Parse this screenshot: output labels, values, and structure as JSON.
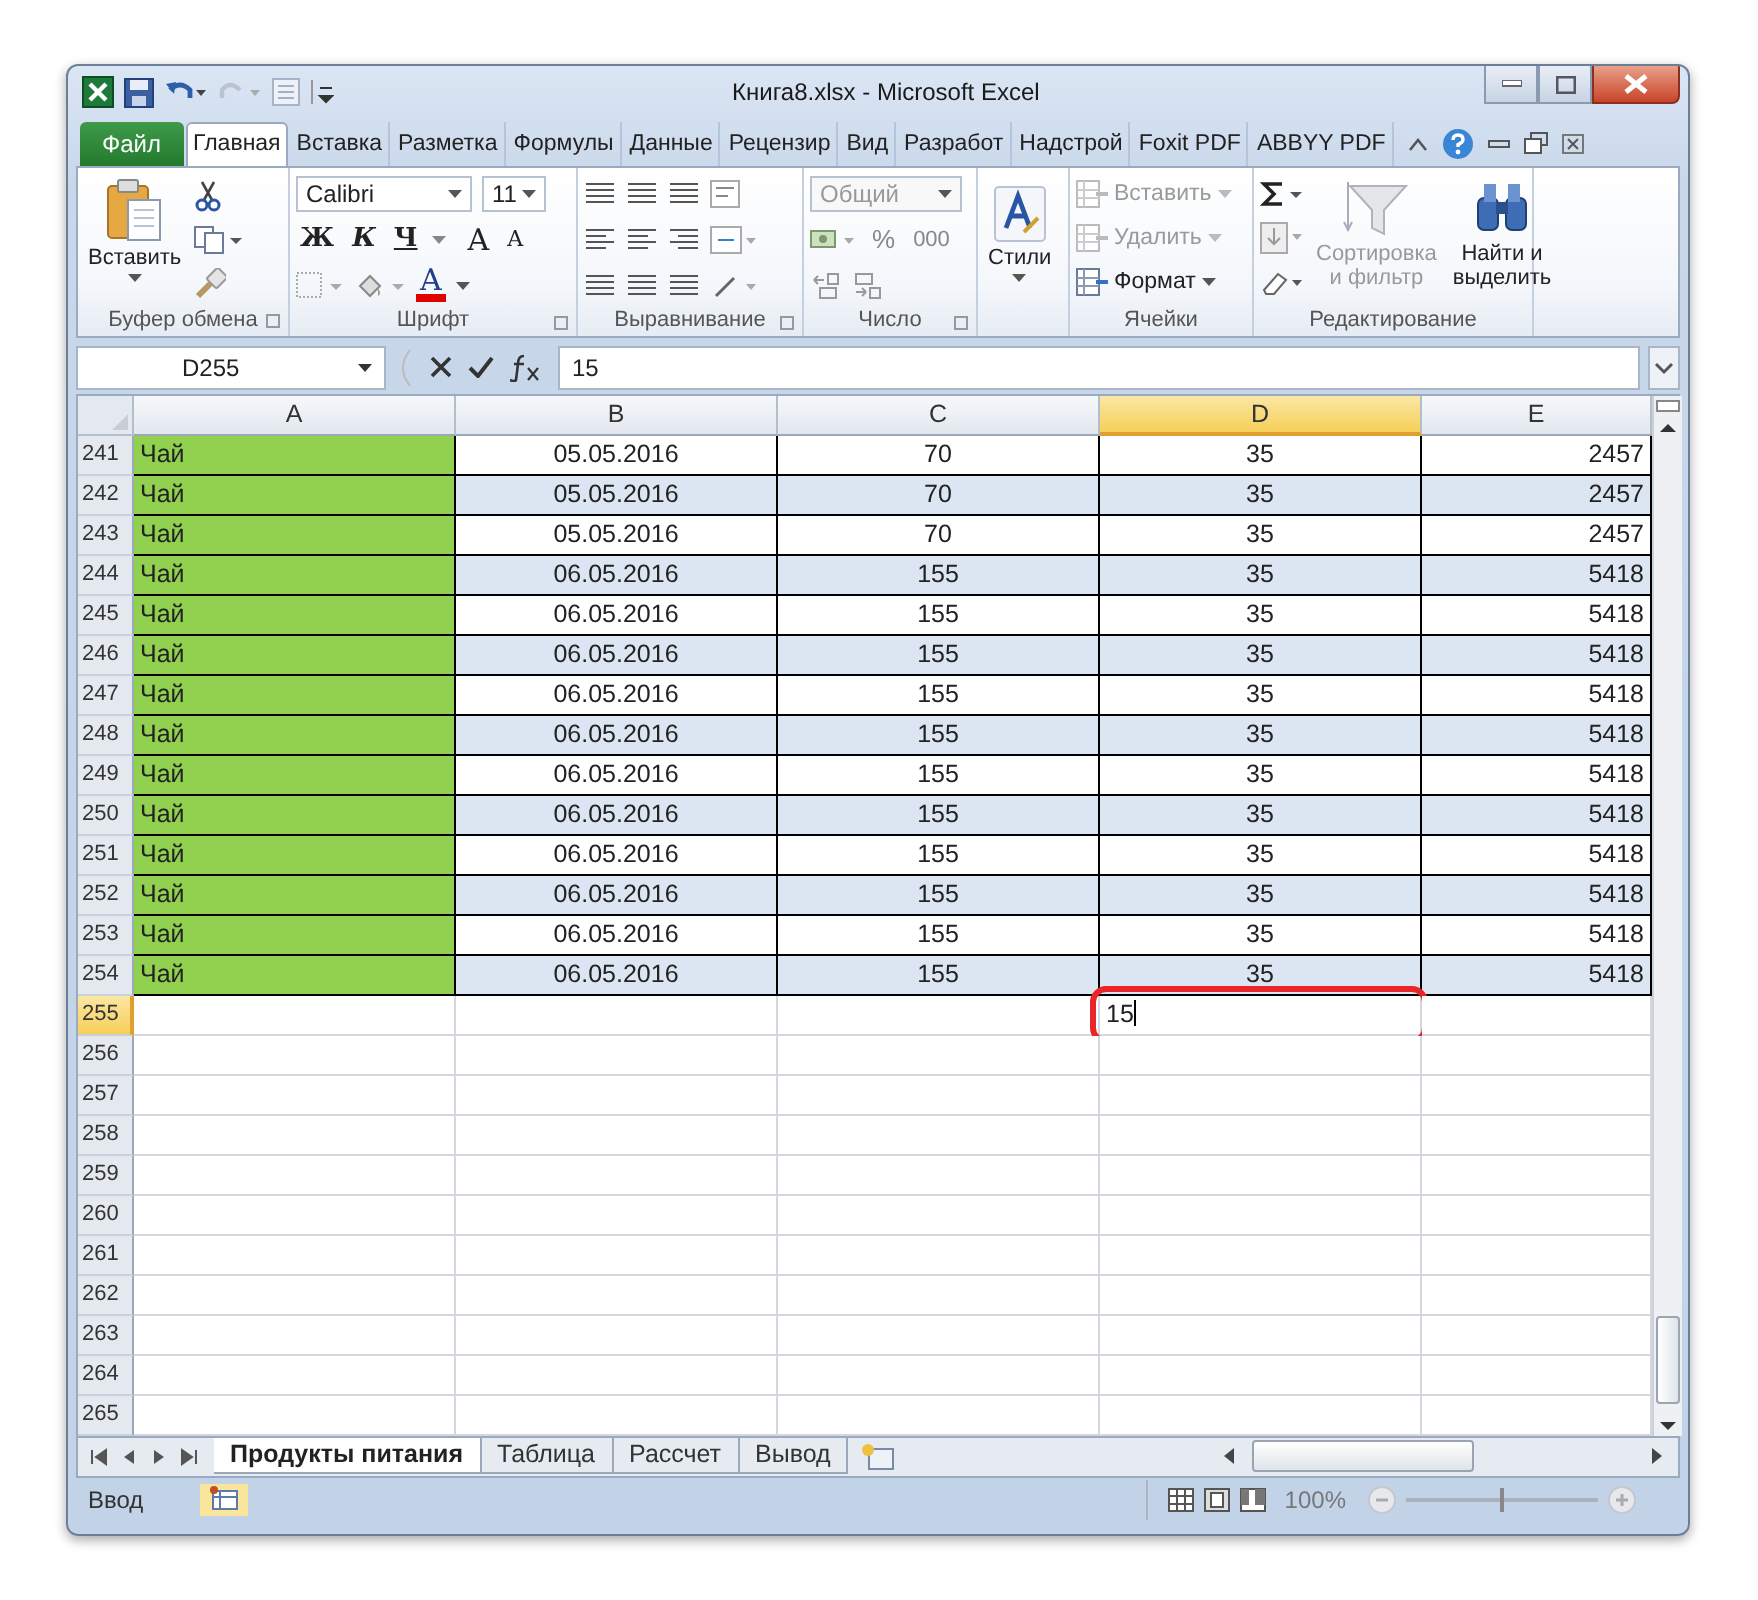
{
  "window": {
    "title": "Книга8.xlsx - Microsoft Excel"
  },
  "ribbon_tabs": [
    {
      "label": "Файл",
      "kind": "file",
      "selected": false
    },
    {
      "label": "Главная",
      "kind": "tab",
      "selected": true
    },
    {
      "label": "Вставка",
      "kind": "tab",
      "selected": false
    },
    {
      "label": "Разметка",
      "kind": "tab",
      "selected": false
    },
    {
      "label": "Формулы",
      "kind": "tab",
      "selected": false
    },
    {
      "label": "Данные",
      "kind": "tab",
      "selected": false
    },
    {
      "label": "Рецензир",
      "kind": "tab",
      "selected": false
    },
    {
      "label": "Вид",
      "kind": "tab",
      "selected": false
    },
    {
      "label": "Разработ",
      "kind": "tab",
      "selected": false
    },
    {
      "label": "Надстрой",
      "kind": "tab",
      "selected": false
    },
    {
      "label": "Foxit PDF",
      "kind": "tab",
      "selected": false
    },
    {
      "label": "ABBYY PDF",
      "kind": "tab",
      "selected": false
    }
  ],
  "clipboard": {
    "paste": "Вставить",
    "label": "Буфер обмена"
  },
  "font": {
    "family": "Calibri",
    "size": "11",
    "bold": "Ж",
    "italic": "К",
    "underline": "Ч",
    "grow": "A",
    "shrink": "A",
    "color_button": "A",
    "label": "Шрифт"
  },
  "alignment": {
    "label": "Выравнивание"
  },
  "number": {
    "format": "Общий",
    "percent": "%",
    "thousands": "000",
    "label": "Число"
  },
  "styles": {
    "label": "Стили"
  },
  "cells": {
    "items": [
      {
        "label": "Вставить",
        "disabled": true
      },
      {
        "label": "Удалить",
        "disabled": true
      },
      {
        "label": "Формат",
        "disabled": false
      }
    ],
    "label": "Ячейки"
  },
  "editing": {
    "sort": {
      "label": "Сортировка и фильтр",
      "disabled": true
    },
    "find": {
      "label": "Найти и выделить",
      "disabled": false
    },
    "label": "Редактирование"
  },
  "formula_bar": {
    "name_box": "D255",
    "value": "15"
  },
  "sheet": {
    "columns": [
      {
        "label": "A",
        "selected": false
      },
      {
        "label": "B",
        "selected": false
      },
      {
        "label": "C",
        "selected": false
      },
      {
        "label": "D",
        "selected": true
      },
      {
        "label": "E",
        "selected": false
      }
    ],
    "rows": [
      {
        "number": "241",
        "selected": false,
        "banded": false,
        "bordered": true,
        "filled": true,
        "cells": {
          "A": "Чай",
          "B": "05.05.2016",
          "C": "70",
          "D": "35",
          "E": "2457"
        }
      },
      {
        "number": "242",
        "selected": false,
        "banded": true,
        "bordered": true,
        "filled": true,
        "cells": {
          "A": "Чай",
          "B": "05.05.2016",
          "C": "70",
          "D": "35",
          "E": "2457"
        }
      },
      {
        "number": "243",
        "selected": false,
        "banded": false,
        "bordered": true,
        "filled": true,
        "cells": {
          "A": "Чай",
          "B": "05.05.2016",
          "C": "70",
          "D": "35",
          "E": "2457"
        }
      },
      {
        "number": "244",
        "selected": false,
        "banded": true,
        "bordered": true,
        "filled": true,
        "cells": {
          "A": "Чай",
          "B": "06.05.2016",
          "C": "155",
          "D": "35",
          "E": "5418"
        }
      },
      {
        "number": "245",
        "selected": false,
        "banded": false,
        "bordered": true,
        "filled": true,
        "cells": {
          "A": "Чай",
          "B": "06.05.2016",
          "C": "155",
          "D": "35",
          "E": "5418"
        }
      },
      {
        "number": "246",
        "selected": false,
        "banded": true,
        "bordered": true,
        "filled": true,
        "cells": {
          "A": "Чай",
          "B": "06.05.2016",
          "C": "155",
          "D": "35",
          "E": "5418"
        }
      },
      {
        "number": "247",
        "selected": false,
        "banded": false,
        "bordered": true,
        "filled": true,
        "cells": {
          "A": "Чай",
          "B": "06.05.2016",
          "C": "155",
          "D": "35",
          "E": "5418"
        }
      },
      {
        "number": "248",
        "selected": false,
        "banded": true,
        "bordered": true,
        "filled": true,
        "cells": {
          "A": "Чай",
          "B": "06.05.2016",
          "C": "155",
          "D": "35",
          "E": "5418"
        }
      },
      {
        "number": "249",
        "selected": false,
        "banded": false,
        "bordered": true,
        "filled": true,
        "cells": {
          "A": "Чай",
          "B": "06.05.2016",
          "C": "155",
          "D": "35",
          "E": "5418"
        }
      },
      {
        "number": "250",
        "selected": false,
        "banded": true,
        "bordered": true,
        "filled": true,
        "cells": {
          "A": "Чай",
          "B": "06.05.2016",
          "C": "155",
          "D": "35",
          "E": "5418"
        }
      },
      {
        "number": "251",
        "selected": false,
        "banded": false,
        "bordered": true,
        "filled": true,
        "cells": {
          "A": "Чай",
          "B": "06.05.2016",
          "C": "155",
          "D": "35",
          "E": "5418"
        }
      },
      {
        "number": "252",
        "selected": false,
        "banded": true,
        "bordered": true,
        "filled": true,
        "cells": {
          "A": "Чай",
          "B": "06.05.2016",
          "C": "155",
          "D": "35",
          "E": "5418"
        }
      },
      {
        "number": "253",
        "selected": false,
        "banded": false,
        "bordered": true,
        "filled": true,
        "cells": {
          "A": "Чай",
          "B": "06.05.2016",
          "C": "155",
          "D": "35",
          "E": "5418"
        }
      },
      {
        "number": "254",
        "selected": false,
        "banded": true,
        "bordered": true,
        "filled": true,
        "cells": {
          "A": "Чай",
          "B": "06.05.2016",
          "C": "155",
          "D": "35",
          "E": "5418"
        }
      },
      {
        "number": "255",
        "selected": true,
        "banded": false,
        "bordered": false,
        "filled": false,
        "editing": true,
        "cells": {
          "D": "15"
        }
      },
      {
        "number": "256",
        "selected": false,
        "banded": false,
        "bordered": false,
        "filled": false
      },
      {
        "number": "257",
        "selected": false,
        "banded": false,
        "bordered": false,
        "filled": false
      },
      {
        "number": "258",
        "selected": false,
        "banded": false,
        "bordered": false,
        "filled": false
      },
      {
        "number": "259",
        "selected": false,
        "banded": false,
        "bordered": false,
        "filled": false
      },
      {
        "number": "260",
        "selected": false,
        "banded": false,
        "bordered": false,
        "filled": false
      },
      {
        "number": "261",
        "selected": false,
        "banded": false,
        "bordered": false,
        "filled": false
      },
      {
        "number": "262",
        "selected": false,
        "banded": false,
        "bordered": false,
        "filled": false
      },
      {
        "number": "263",
        "selected": false,
        "banded": false,
        "bordered": false,
        "filled": false
      },
      {
        "number": "264",
        "selected": false,
        "banded": false,
        "bordered": false,
        "filled": false
      },
      {
        "number": "265",
        "selected": false,
        "banded": false,
        "bordered": false,
        "filled": false
      }
    ]
  },
  "sheet_tabs": [
    {
      "label": "Продукты питания",
      "selected": true
    },
    {
      "label": "Таблица",
      "selected": false
    },
    {
      "label": "Рассчет",
      "selected": false
    },
    {
      "label": "Вывод",
      "selected": false
    }
  ],
  "status_bar": {
    "mode": "Ввод",
    "zoom": "100%",
    "zoom_slider": {
      "level": 0.5
    }
  }
}
